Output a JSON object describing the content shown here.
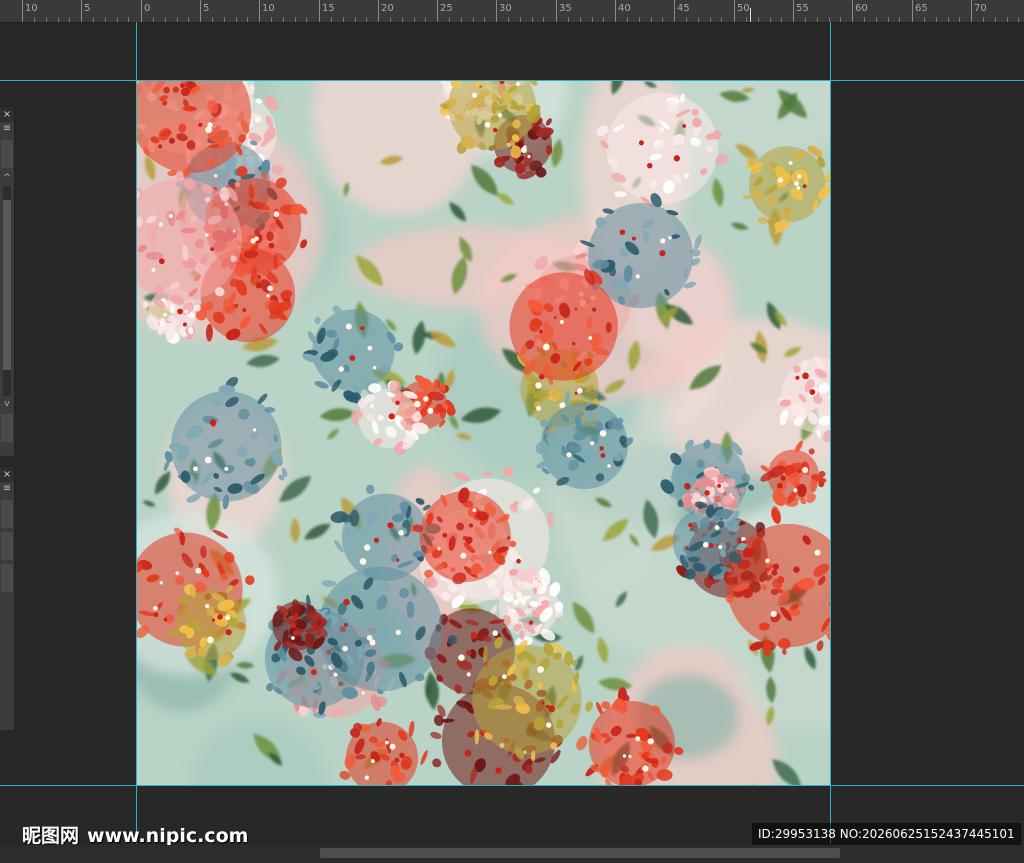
{
  "ruler": {
    "labels": [
      "10",
      "5",
      "0",
      "5",
      "10",
      "15",
      "20",
      "25",
      "30",
      "35",
      "40",
      "45",
      "50",
      "55",
      "60",
      "65",
      "70"
    ]
  },
  "panels": {
    "close_glyph": "×",
    "menu_glyph": "≡",
    "scroll_up_glyph": "^",
    "scroll_down_glyph": "v"
  },
  "canvas": {
    "content": "floral pattern artwork",
    "palette": [
      "#e3391f",
      "#b01a18",
      "#6e1714",
      "#f2a8a8",
      "#fbe9ea",
      "#5f8fa0",
      "#2f5c6b",
      "#a5c3b8",
      "#b7a33a",
      "#f4c04a"
    ]
  },
  "watermark": {
    "brand": "昵图网",
    "site": "www.nipic.com",
    "id_text": "ID:29953138 NO:20260625152437445101"
  },
  "colors": {
    "guide": "#29b6c8",
    "background": "#282828",
    "ruler": "#3a3a3a"
  }
}
